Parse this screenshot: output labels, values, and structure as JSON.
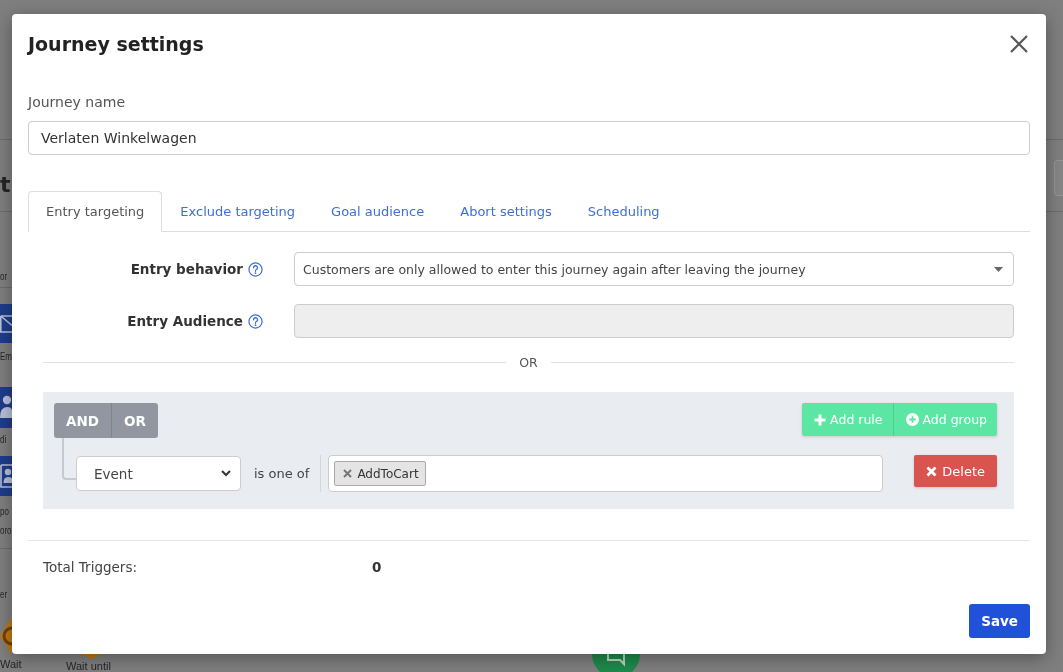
{
  "background_page": {
    "heading": "t",
    "section_labels": [
      "or",
      "er"
    ],
    "tool_captions": [
      [
        "Em"
      ],
      [
        "di"
      ],
      [
        "po",
        "oro"
      ]
    ],
    "bottom_captions": [
      "Wait",
      "Wait until"
    ]
  },
  "dialog": {
    "title": "Journey settings"
  },
  "journey_name": {
    "label": "Journey name",
    "value": "Verlaten Winkelwagen"
  },
  "tabs": [
    {
      "label": "Entry targeting",
      "selected": true
    },
    {
      "label": "Exclude targeting",
      "selected": false
    },
    {
      "label": "Goal audience",
      "selected": false
    },
    {
      "label": "Abort settings",
      "selected": false
    },
    {
      "label": "Scheduling",
      "selected": false
    }
  ],
  "entry_behavior": {
    "label": "Entry behavior",
    "value": "Customers are only allowed to enter this journey again after leaving the journey"
  },
  "entry_audience": {
    "label": "Entry Audience",
    "disabled": true
  },
  "divider_label": "OR",
  "query_builder": {
    "conjunctions": [
      "AND",
      "OR"
    ],
    "actions": [
      "Add rule",
      "Add group"
    ],
    "rules": [
      {
        "field": "Event",
        "operator": "is one of",
        "tags": [
          "AddToCart"
        ],
        "delete_label": "Delete"
      }
    ]
  },
  "total_triggers": {
    "label": "Total Triggers:",
    "value": "0"
  },
  "save_label": "Save"
}
